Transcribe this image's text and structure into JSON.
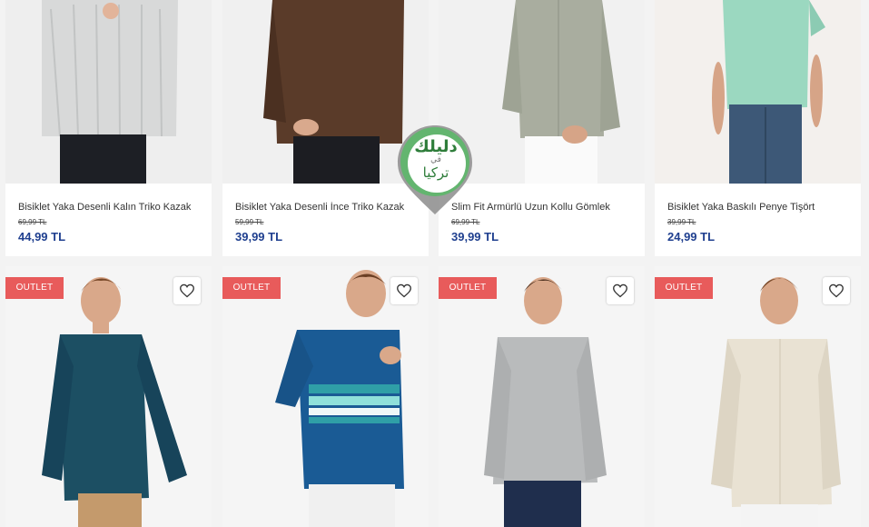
{
  "colors": {
    "price": "#1f3f8f",
    "badge": "#e85b5b",
    "watermark_green": "#63b56f"
  },
  "products_top": [
    {
      "name": "Bisiklet Yaka Desenli Kalın Triko Kazak",
      "old_price": "69,99 TL",
      "price": "44,99 TL",
      "color": "#d9dada"
    },
    {
      "name": "Bisiklet Yaka Desenli İnce Triko Kazak",
      "old_price": "59,99 TL",
      "price": "39,99 TL",
      "color": "#5a3b29"
    },
    {
      "name": "Slim Fit Armürlü Uzun Kollu Gömlek",
      "old_price": "69,99 TL",
      "price": "39,99 TL",
      "color": "#a9ad9f"
    },
    {
      "name": "Bisiklet Yaka Baskılı Penye Tişört",
      "old_price": "39,99 TL",
      "price": "24,99 TL",
      "color": "#9bd8c0"
    }
  ],
  "products_bottom": [
    {
      "badge": "OUTLET",
      "color": "#1c4f63",
      "favorite_icon": "heart-outline-icon"
    },
    {
      "badge": "OUTLET",
      "color": "#1a5b95",
      "favorite_icon": "heart-outline-icon"
    },
    {
      "badge": "OUTLET",
      "color": "#b9bbbc",
      "favorite_icon": "heart-outline-icon"
    },
    {
      "badge": "OUTLET",
      "color": "#e9e2d3",
      "favorite_icon": "heart-outline-icon"
    }
  ],
  "watermark": {
    "line1": "دليلك",
    "line2": "في",
    "line3": "تركيا"
  }
}
